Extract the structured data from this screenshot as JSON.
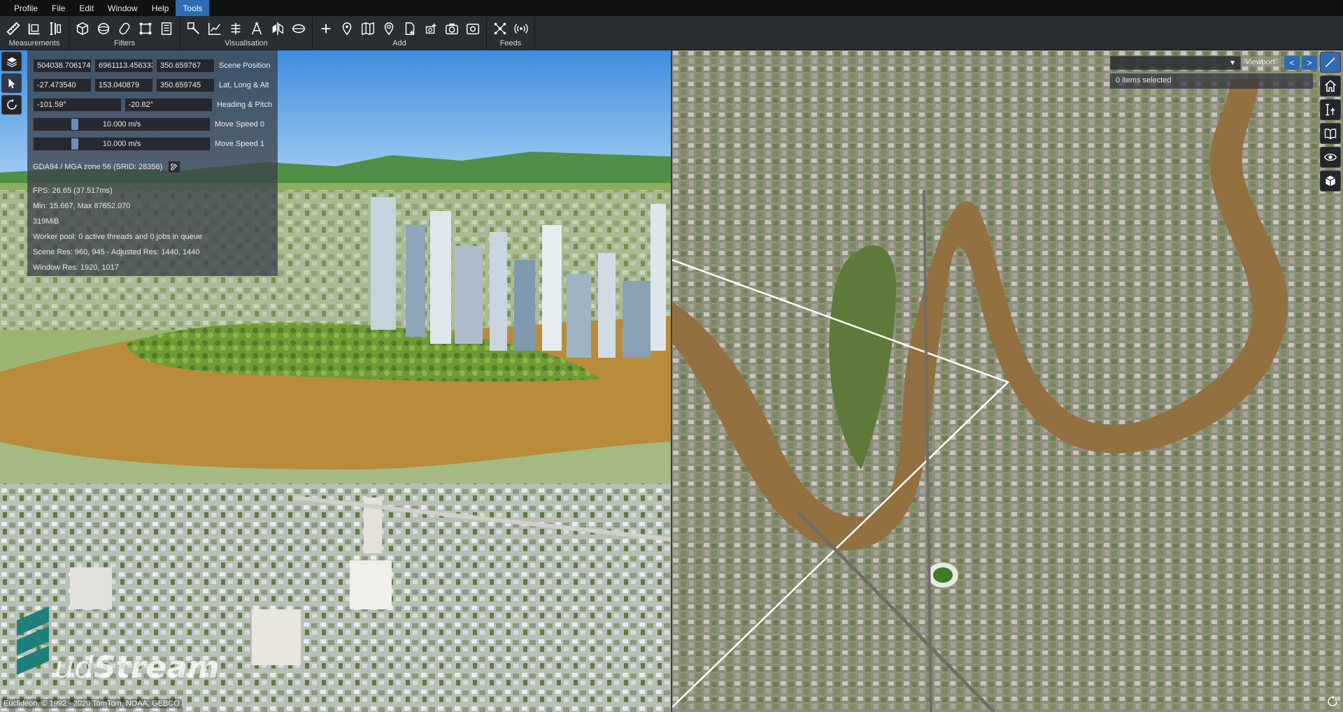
{
  "menu": {
    "items": [
      {
        "label": "Profile"
      },
      {
        "label": "File"
      },
      {
        "label": "Edit"
      },
      {
        "label": "Window"
      },
      {
        "label": "Help"
      },
      {
        "label": "Tools"
      }
    ],
    "active": "Tools"
  },
  "toolbar": {
    "groups": [
      {
        "label": "Measurements",
        "icons": [
          "ruler-icon",
          "area-measure-icon",
          "height-measure-icon"
        ]
      },
      {
        "label": "Filters",
        "icons": [
          "box-filter-icon",
          "sphere-filter-icon",
          "capsule-filter-icon",
          "cross-section-icon",
          "voxel-filter-icon"
        ]
      },
      {
        "label": "Visualisation",
        "icons": [
          "inspect-icon",
          "line-chart-icon",
          "height-lines-icon",
          "compass-icon",
          "split-view-icon",
          "ellipse-icon"
        ]
      },
      {
        "label": "Add",
        "icons": [
          "add-icon",
          "add-poi-icon",
          "add-map-icon",
          "add-pin-icon",
          "add-file-icon",
          "add-camera-icon",
          "add-photo-icon",
          "add-screenshot-icon"
        ]
      },
      {
        "label": "Feeds",
        "icons": [
          "network-icon",
          "broadcast-icon"
        ]
      }
    ]
  },
  "info": {
    "scene_position": {
      "x": "504038.706174",
      "y": "6961113.456333",
      "z": "350.659767",
      "label": "Scene Position"
    },
    "lat_long_alt": {
      "lat": "-27.473540",
      "long": "153.040879",
      "alt": "350.659745",
      "label": "Lat, Long & Alt"
    },
    "heading_pitch": {
      "heading": "-101.59°",
      "pitch": "-20.82°",
      "label": "Heading & Pitch"
    },
    "move_speed_0": {
      "value": "10.000 m/s",
      "label": "Move Speed 0"
    },
    "move_speed_1": {
      "value": "10.000 m/s",
      "label": "Move Speed 1"
    },
    "srs": "GDA94 / MGA zone 56 (SRID: 28356)",
    "stats": {
      "fps": "FPS: 26.65 (37.517ms)",
      "minmax": "Min: 15.667, Max 87652.070",
      "memory": "319MiB",
      "worker_pool": "Worker pool: 0 active threads and 0 jobs in queue",
      "scene_res": "Scene Res: 960, 945 - Adjusted Res: 1440, 1440",
      "window_res": "Window Res: 1920, 1017"
    }
  },
  "left_tools": [
    "layers-icon",
    "select-cursor-icon",
    "rotate-icon"
  ],
  "right_tools": [
    "compass-needle-icon",
    "home-icon",
    "map-height-icon",
    "book-icon",
    "eye-icon",
    "cube-icon"
  ],
  "viewport": {
    "label": "Viewport",
    "prev": "<",
    "next": ">",
    "selected_text": "0 items selected"
  },
  "copyright": "Euclideon, © 1992 - 2020 TomTom, NOAA, GEBCO",
  "logo": {
    "prefix": "ud",
    "name": "Stream"
  },
  "colors": {
    "accent": "#2d6bb3",
    "river": "#a8762a",
    "panel": "#3c424a"
  }
}
